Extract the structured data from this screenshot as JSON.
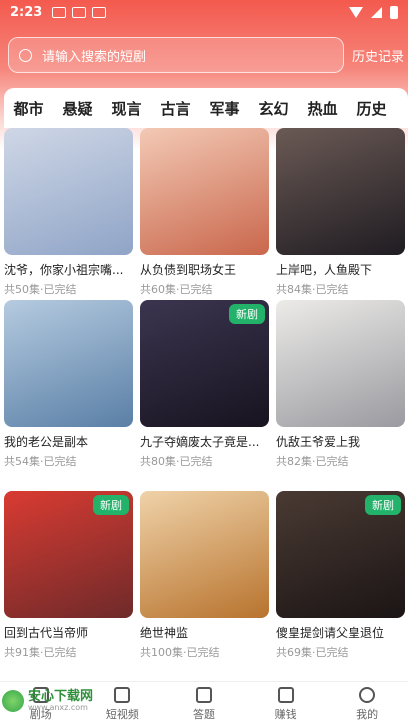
{
  "status_bar": {
    "time": "2:23"
  },
  "search": {
    "placeholder": "请输入搜索的短剧",
    "history_label": "历史记录"
  },
  "tabs": [
    "都市",
    "悬疑",
    "现言",
    "古言",
    "军事",
    "玄幻",
    "热血",
    "历史"
  ],
  "dramas": [
    {
      "title": "沈爷，你家小祖宗嘴...",
      "meta": "共50集·已完结",
      "badge": "",
      "color1": "#cfd7e6",
      "color2": "#8fa4c7"
    },
    {
      "title": "从负债到职场女王",
      "meta": "共60集·已完结",
      "badge": "",
      "color1": "#f3c9b5",
      "color2": "#c9674c"
    },
    {
      "title": "上岸吧，人鱼殿下",
      "meta": "共84集·已完结",
      "badge": "",
      "color1": "#6b5a55",
      "color2": "#1f1c22"
    },
    {
      "title": "我的老公是副本",
      "meta": "共54集·已完结",
      "badge": "",
      "color1": "#b5cbe0",
      "color2": "#5a7fa6"
    },
    {
      "title": "九子夺嫡废太子竟是...",
      "meta": "共80集·已完结",
      "badge": "新剧",
      "color1": "#3b3550",
      "color2": "#18131f"
    },
    {
      "title": "仇敌王爷爱上我",
      "meta": "共82集·已完结",
      "badge": "",
      "color1": "#ecebe8",
      "color2": "#9a9aa0"
    },
    {
      "title": "回到古代当帝师",
      "meta": "共91集·已完结",
      "badge": "新剧",
      "color1": "#d93b32",
      "color2": "#6e2a2a"
    },
    {
      "title": "绝世神监",
      "meta": "共100集·已完结",
      "badge": "",
      "color1": "#efd2a8",
      "color2": "#b8732e"
    },
    {
      "title": "傻皇提剑请父皇退位",
      "meta": "共69集·已完结",
      "badge": "新剧",
      "color1": "#4a3a33",
      "color2": "#1b1515"
    }
  ],
  "bottom_nav": [
    "剧场",
    "短视频",
    "答题",
    "赚钱",
    "我的"
  ],
  "watermark": {
    "name": "安心下载网",
    "url": "www.anxz.com"
  }
}
